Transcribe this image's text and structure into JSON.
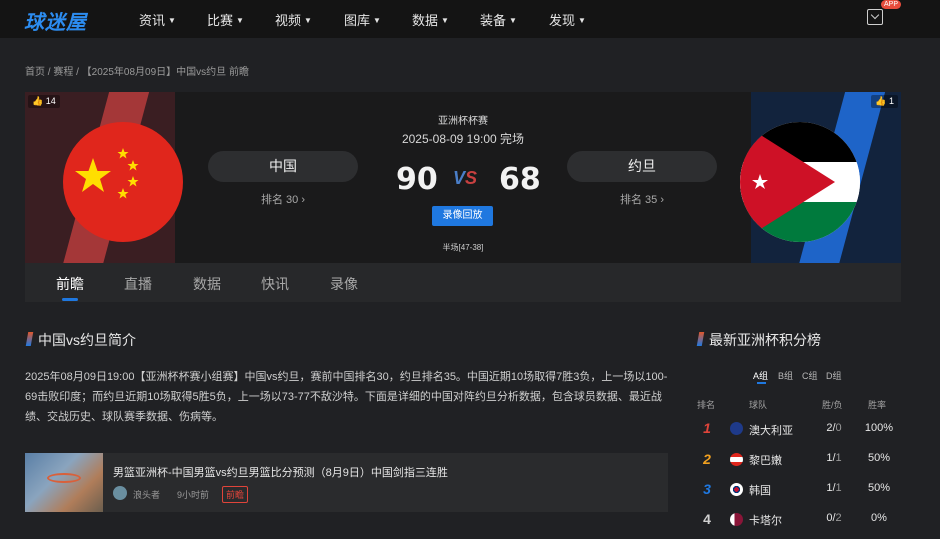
{
  "nav": {
    "logo": "球迷屋",
    "items": [
      "资讯",
      "比赛",
      "视频",
      "图库",
      "数据",
      "装备",
      "发现"
    ],
    "app_badge": "APP"
  },
  "breadcrumb": "首页 / 赛程 / 【2025年08月09日】中国vs约旦 前瞻",
  "match": {
    "league": "亚洲杯杯赛",
    "datetime": "2025-08-09 19:00 完场",
    "home": {
      "name": "中国",
      "rank": "排名 30 ›",
      "score": "90",
      "likes": "14"
    },
    "away": {
      "name": "约旦",
      "rank": "排名 35 ›",
      "score": "68",
      "likes": "1"
    },
    "vs_v": "V",
    "vs_s": "S",
    "replay": "录像回放",
    "halftime": "半场[47-38]"
  },
  "tabs": [
    "前瞻",
    "直播",
    "数据",
    "快讯",
    "录像"
  ],
  "intro": {
    "title": "中国vs约旦简介",
    "text": "2025年08月09日19:00【亚洲杯杯赛小组赛】中国vs约旦，赛前中国排名30，约旦排名35。中国近期10场取得7胜3负，上一场以100-69击败印度；而约旦近期10场取得5胜5负，上一场以73-77不敌沙特。下面是详细的中国对阵约旦分析数据，包含球员数据、最近战绩、交战历史、球队赛季数据、伤病等。"
  },
  "news": {
    "title": "男篮亚洲杯-中国男篮vs约旦男篮比分预测（8月9日）中国剑指三连胜",
    "author": "浪头者",
    "time": "9小时前",
    "tag": "前瞻"
  },
  "standings": {
    "title": "最新亚洲杯积分榜",
    "groups": [
      "A组",
      "B组",
      "C组",
      "D组"
    ],
    "headers": {
      "rank": "排名",
      "team": "球队",
      "wl": "胜/负",
      "rate": "胜率"
    },
    "rows": [
      {
        "rank": "1",
        "team": "澳大利亚",
        "w": "2",
        "l": "0",
        "rate": "100%",
        "color": "#e0443a"
      },
      {
        "rank": "2",
        "team": "黎巴嫩",
        "w": "1",
        "l": "1",
        "rate": "50%",
        "color": "#f0a020"
      },
      {
        "rank": "3",
        "team": "韩国",
        "w": "1",
        "l": "1",
        "rate": "50%",
        "color": "#1f78e0"
      },
      {
        "rank": "4",
        "team": "卡塔尔",
        "w": "0",
        "l": "2",
        "rate": "0%",
        "color": "#d0d0d0"
      }
    ]
  }
}
